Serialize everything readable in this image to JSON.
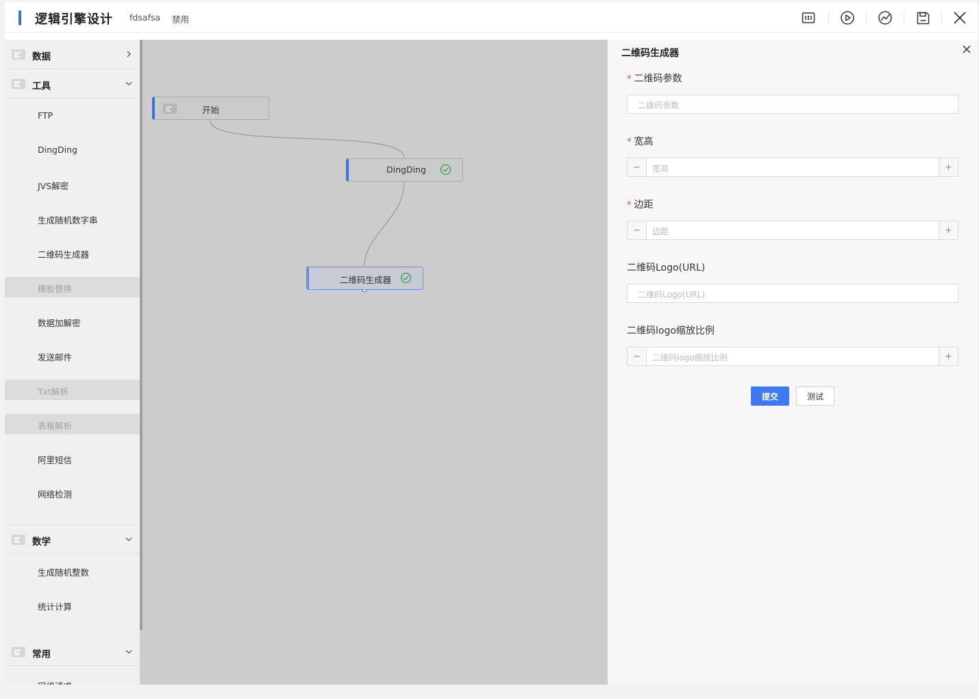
{
  "header": {
    "title": "逻辑引擎设计",
    "name": "fdsafsa",
    "status": "禁用",
    "tools": [
      "fit-ratio-icon",
      "run-icon",
      "monitor-icon",
      "save-icon",
      "close-icon"
    ]
  },
  "sidebar": {
    "groups": [
      {
        "label": "数据",
        "expanded": false,
        "items": []
      },
      {
        "label": "工具",
        "expanded": true,
        "items": [
          {
            "label": "FTP",
            "disabled": false
          },
          {
            "label": "DingDing",
            "disabled": false
          },
          {
            "label": "JVS解密",
            "disabled": false
          },
          {
            "label": "生成随机数字串",
            "disabled": false
          },
          {
            "label": "二维码生成器",
            "disabled": false
          },
          {
            "label": "模板替换",
            "disabled": true
          },
          {
            "label": "数据加解密",
            "disabled": false
          },
          {
            "label": "发送邮件",
            "disabled": false
          },
          {
            "label": "Txt解析",
            "disabled": true
          },
          {
            "label": "表格解析",
            "disabled": true
          },
          {
            "label": "阿里短信",
            "disabled": false
          },
          {
            "label": "网络检测",
            "disabled": false
          }
        ]
      },
      {
        "label": "数学",
        "expanded": true,
        "items": [
          {
            "label": "生成随机整数",
            "disabled": false
          },
          {
            "label": "统计计算",
            "disabled": false
          }
        ]
      },
      {
        "label": "常用",
        "expanded": true,
        "items": [
          {
            "label": "网络请求",
            "disabled": false
          }
        ]
      }
    ]
  },
  "canvas": {
    "nodes": [
      {
        "label": "开始",
        "status": ""
      },
      {
        "label": "DingDing",
        "status": "success"
      },
      {
        "label": "二维码生成器",
        "status": "success",
        "selected": true
      }
    ]
  },
  "panel": {
    "title": "二维码生成器",
    "fields": [
      {
        "label": "二维码参数",
        "required": true,
        "type": "text",
        "placeholder": "二维码参数"
      },
      {
        "label": "宽高",
        "required": true,
        "type": "number",
        "placeholder": "宽高"
      },
      {
        "label": "边距",
        "required": true,
        "type": "number",
        "placeholder": "边距"
      },
      {
        "label": "二维码Logo(URL)",
        "required": false,
        "type": "text",
        "placeholder": "二维码Logo(URL)"
      },
      {
        "label": "二维码logo缩放比例",
        "required": false,
        "type": "number",
        "placeholder": "二维码logo缩放比例"
      }
    ],
    "submit_label": "提交",
    "test_label": "测试",
    "minus": "−",
    "plus": "+"
  },
  "colors": {
    "accent": "#3f6fde",
    "primary_button": "#3f78f2",
    "required": "#e84c4c",
    "success": "#3a9a45",
    "canvas": "#cccccc"
  }
}
